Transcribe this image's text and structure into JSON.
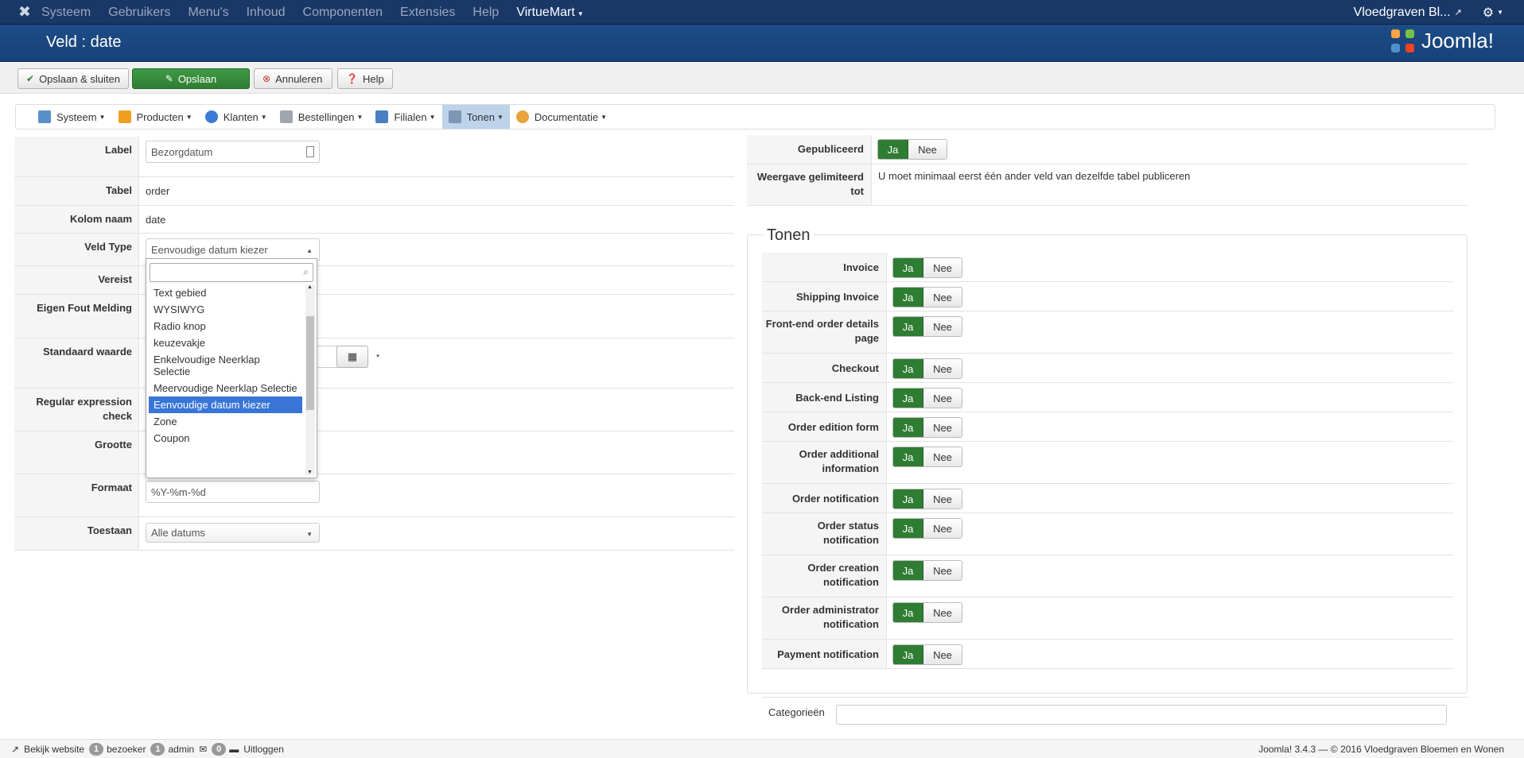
{
  "navbar": {
    "items": [
      "Systeem",
      "Gebruikers",
      "Menu's",
      "Inhoud",
      "Componenten",
      "Extensies",
      "Help"
    ],
    "virtuemart": "VirtueMart",
    "user": "Vloedgraven Bl..."
  },
  "title": "Veld : date",
  "brand": "Joomla!",
  "toolbar": {
    "save_close": "Opslaan & sluiten",
    "save": "Opslaan",
    "cancel": "Annuleren",
    "help": "Help"
  },
  "vmmenu": [
    "Systeem",
    "Producten",
    "Klanten",
    "Bestellingen",
    "Filialen",
    "Tonen",
    "Documentatie"
  ],
  "colors": {
    "active_tab": "#bcd3ea",
    "toggle_green": "#2f7d32",
    "navbar": "#1a3867"
  },
  "form": {
    "label": {
      "label": "Label",
      "value": "Bezorgdatum"
    },
    "tabel": {
      "label": "Tabel",
      "value": "order"
    },
    "kolom": {
      "label": "Kolom naam",
      "value": "date"
    },
    "veldtype": {
      "label": "Veld Type",
      "value": "Eenvoudige datum kiezer"
    },
    "vereist": {
      "label": "Vereist"
    },
    "foutmelding": {
      "label": "Eigen Fout Melding"
    },
    "standaard": {
      "label": "Standaard waarde",
      "star": "*"
    },
    "regex": {
      "label": "Regular expression check"
    },
    "grootte": {
      "label": "Grootte"
    },
    "formaat": {
      "label": "Formaat",
      "value": "%Y-%m-%d"
    },
    "toestaan": {
      "label": "Toestaan",
      "value": "Alle datums"
    }
  },
  "dropdown_options": [
    "Text gebied",
    "WYSIWYG",
    "Radio knop",
    "keuzevakje",
    "Enkelvoudige Neerklap Selectie",
    "Meervoudige Neerklap Selectie",
    "Eenvoudige datum kiezer",
    "Zone",
    "Coupon"
  ],
  "dropdown_selected": "Eenvoudige datum kiezer",
  "right": {
    "gepubliceerd": "Gepubliceerd",
    "weergave_label": "Weergave gelimiteerd tot",
    "weergave_text": "U moet minimaal eerst één ander veld van dezelfde tabel publiceren",
    "ja": "Ja",
    "nee": "Nee",
    "tonen": "Tonen",
    "tonen_items": [
      "Invoice",
      "Shipping Invoice",
      "Front-end order details page",
      "Checkout",
      "Back-end Listing",
      "Order edition form",
      "Order additional information",
      "Order notification",
      "Order status notification",
      "Order creation notification",
      "Order administrator notification",
      "Payment notification"
    ],
    "categorieen": "Categorieën"
  },
  "status": {
    "bekijk": "Bekijk website",
    "bezoeker_count": "1",
    "bezoeker": "bezoeker",
    "admin_count": "1",
    "admin": "admin",
    "msg_count": "0",
    "uitloggen": "Uitloggen",
    "version": "Joomla! 3.4.3 — © 2016 Vloedgraven Bloemen en Wonen"
  }
}
